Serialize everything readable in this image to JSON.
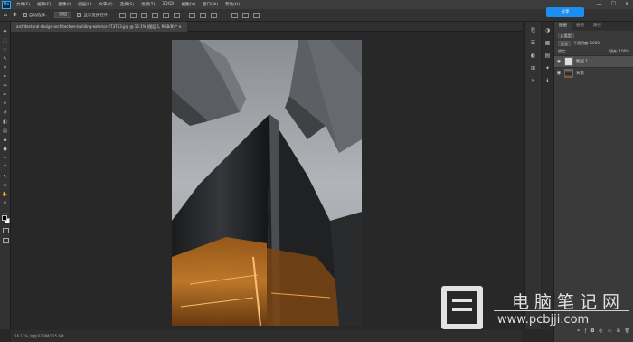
{
  "app": {
    "logo": "Ps"
  },
  "menubar": {
    "items": [
      "文件(F)",
      "编辑(E)",
      "图像(I)",
      "图层(L)",
      "文字(Y)",
      "选择(S)",
      "滤镜(T)",
      "3D(D)",
      "视图(V)",
      "窗口(W)",
      "帮助(H)"
    ],
    "window_controls": [
      "—",
      "☐",
      "✕"
    ]
  },
  "options_bar": {
    "auto_select_label": "自动选择：",
    "auto_select_value": "图层",
    "transform_label": "显示变换控件"
  },
  "share_button": "分享",
  "document_tab": {
    "label": "architectural-design-architecture-building-exterior-273763.jpg @ 16.1% (图层 1, RGB/8) *  ✕"
  },
  "statusbar": {
    "text": "16.13%    文档:62.8M/125.6M"
  },
  "layers_panel": {
    "tabs": [
      "图层",
      "通道",
      "路径"
    ],
    "filter_label": "ρ 类型",
    "blend_mode": "正常",
    "opacity_label": "不透明度: 100%",
    "lock_label": "锁定:",
    "fill_label": "填充: 100%",
    "layers": [
      {
        "name": "图层 1",
        "selected": true
      },
      {
        "name": "背景",
        "selected": false
      }
    ]
  },
  "watermark": {
    "cn": "电脑笔记网",
    "url": "www.pcbjji.com"
  }
}
